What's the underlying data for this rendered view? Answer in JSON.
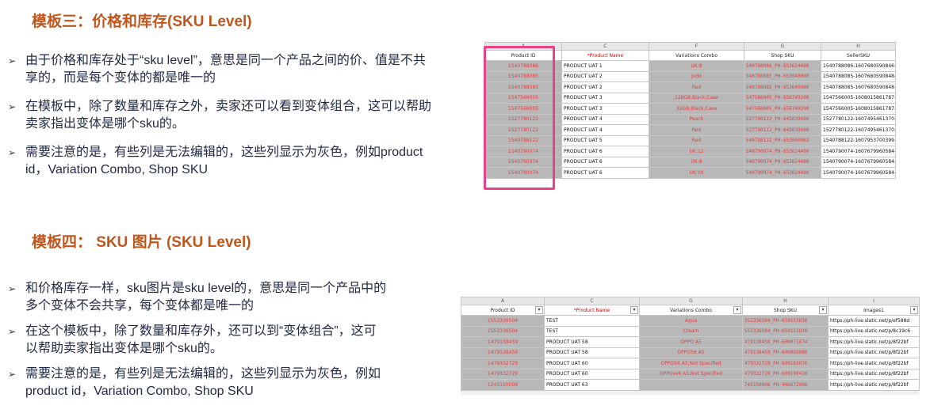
{
  "section3": {
    "title": "模板三：价格和库存(SKU Level)",
    "bullets": [
      "由于价格和库存处于“sku level”，意思是同一个产品之间的价、值是不共享的，而是每个变体的都是唯一的",
      "在模板中，除了数量和库存之外，卖家还可以看到变体组合，这可以帮助卖家指出变体是哪个sku的。",
      "需要注意的是，有些列是无法编辑的，这些列显示为灰色，例如product id，Variation Combo, Shop SKU"
    ],
    "sheet": {
      "col_letters": [
        "A",
        "C",
        "F",
        "G",
        "H"
      ],
      "headers": [
        "Product ID",
        "*Product Name",
        "Variations Combo",
        "Shop SKU",
        "SellerSKU"
      ],
      "rows": [
        [
          "1540788086",
          "PRODUCT UAT 1",
          "UK:8",
          "540788086_PH-653624400",
          "1540788086-1607680590846-0"
        ],
        [
          "1540788085",
          "PRODUCT UAT 2",
          "Judo",
          "540788085_PH-653640080",
          "1540788085-1607680590848-1"
        ],
        [
          "1540788085",
          "PRODUCT UAT 2",
          "Red",
          "540788085_PH-653640080",
          "1540788085-1607680590848-0"
        ],
        [
          "1547566005",
          "PRODUCT UAT 3",
          "128GB,Black,Case",
          "547566005_PH-656749200",
          "1547566005-1608015861787-0"
        ],
        [
          "1547566005",
          "PRODUCT UAT 3",
          "32GB,Black,Case",
          "547566005_PH-656749200",
          "1547566005-1608015861787-1"
        ],
        [
          "1527780122",
          "PRODUCT UAT 4",
          "Peach",
          "527780122_PH-645839600",
          "1527780122-1607495461370-1"
        ],
        [
          "1527780122",
          "PRODUCT UAT 4",
          "Red",
          "527780122_PH-645839600",
          "1527780122-1607495461370-0"
        ],
        [
          "1540788122",
          "PRODUCT UAT 5",
          "Red",
          "540788122_PH-653640083",
          "1540788122-1607953700399-0"
        ],
        [
          "1540790074",
          "PRODUCT UAT 6",
          "UK:12",
          "540790074_PH-653624400",
          "1540790074-1607679960584-2"
        ],
        [
          "1540790074",
          "PRODUCT UAT 6",
          "UK:8",
          "540790074_PH-653624400",
          "1540790074-1607679960584-0"
        ],
        [
          "1540790074",
          "PRODUCT UAT 6",
          "UK:10",
          "540790074_PH-653624400",
          "1540790074-1607679960584-1"
        ]
      ]
    }
  },
  "section4": {
    "title": "模板四： SKU 图片 (SKU Level)",
    "bullets": [
      "和价格库存一样，sku图片是sku level的，意思是同一个产品中的多个变体不会共享，每个变体都是唯一的",
      "在这个模板中，除了数量和库存外，还可以到“变体组合”，这可以帮助卖家指出变体是哪个sku的。",
      "需要注意的是，有些列是无法编辑的，这些列显示为灰色，例如product id，Variation Combo, Shop SKU"
    ],
    "sheet": {
      "col_letters": [
        "A",
        "C",
        "G",
        "H",
        "I"
      ],
      "headers": [
        "Product ID",
        "*Product Name",
        "Variations Combo",
        "Shop SKU",
        "Images1"
      ],
      "rows": [
        [
          "1552336504",
          "TEST",
          "Aqua",
          "552336504_PH-659151838",
          "https://ph-live.slatic.net/p/ef588d"
        ],
        [
          "1552336504",
          "TEST",
          "Cream",
          "552336504_PH-659151838",
          "https://ph-live.slatic.net/p/8c19c6"
        ],
        [
          "1479138459",
          "PRODUCT UAT 58",
          "OPPO A5",
          "479138459_PH-609071874",
          "https://ph-live.slatic.net/p/8f22bf"
        ],
        [
          "1479138459",
          "PRODUCT UAT 58",
          "OPPO56 A5",
          "479138459_PH-609069088",
          "https://ph-live.slatic.net/p/8f22bf"
        ],
        [
          "1479332729",
          "PRODUCT UAT 60",
          "OPPO56 A5,Not Specified",
          "479332729_PH-609183076",
          "https://ph-live.slatic.net/p/8f22bf"
        ],
        [
          "1479332729",
          "PRODUCT UAT 60",
          "OPPOse6 A5,Not Specified",
          "479332729_PH-609190426",
          "https://ph-live.slatic.net/p/8f22bf"
        ],
        [
          "1245150006",
          "PRODUCT UAT 63",
          "",
          "745150006_PH-446672008",
          "https://ph-live.slatic.net/p/8f22bf"
        ]
      ]
    }
  },
  "colors": {
    "heading": "#c0561b",
    "highlight": "#e8438a",
    "locked_cell": "#b8b8b8",
    "locked_text": "#d94343"
  },
  "icons": {
    "bullet": "arrow-bullet-icon"
  }
}
